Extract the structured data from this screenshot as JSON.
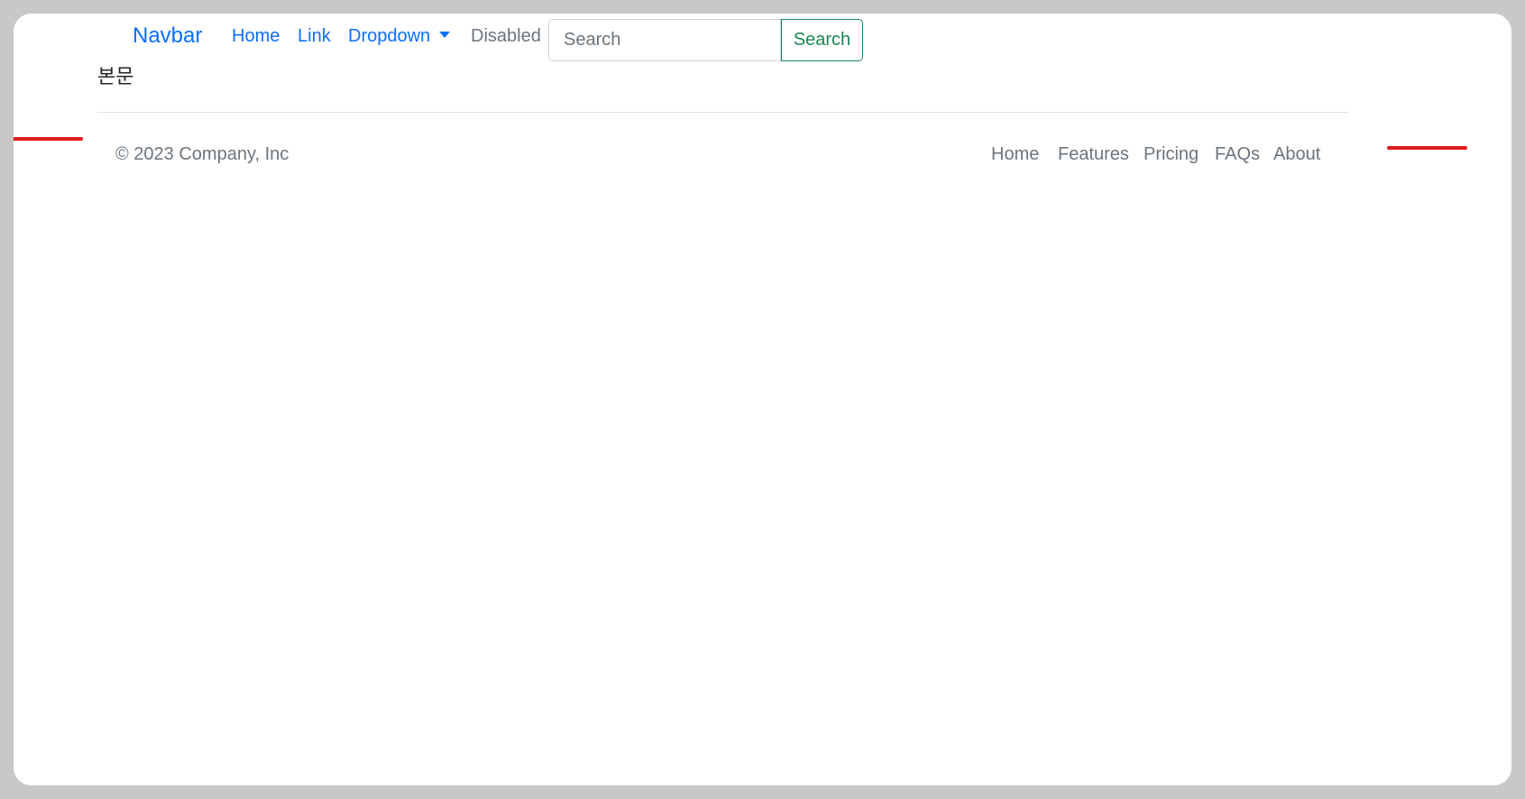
{
  "navbar": {
    "brand": "Navbar",
    "links": {
      "home": "Home",
      "link": "Link",
      "dropdown": "Dropdown",
      "disabled": "Disabled"
    },
    "search": {
      "placeholder": "Search",
      "value": "",
      "button_label": "Search"
    }
  },
  "main": {
    "body_text": "본문"
  },
  "footer": {
    "copyright": "© 2023 Company, Inc",
    "nav": {
      "home": "Home",
      "features": "Features",
      "pricing": "Pricing",
      "faqs": "FAQs",
      "about": "About"
    }
  },
  "colors": {
    "link_primary": "#0d6efd",
    "muted": "#6c757d",
    "success": "#198754",
    "annotation_red": "#e01b1b",
    "backdrop": "#c8c8c8"
  },
  "icons": {
    "dropdown_caret": "caret-down-icon"
  }
}
